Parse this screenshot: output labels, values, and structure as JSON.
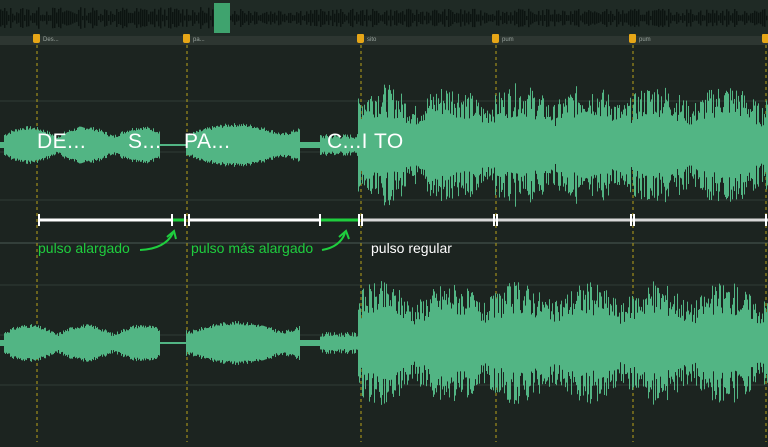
{
  "colors": {
    "background": "#1c2420",
    "waveform": "#52b584",
    "marker": "#e6a617",
    "annotation_green": "#1fce3e",
    "annotation_white": "#ffffff",
    "grid": "#3b4a44"
  },
  "markers": [
    {
      "label": "Des..."
    },
    {
      "label": "pa..."
    },
    {
      "label": "sito"
    },
    {
      "label": "pum"
    },
    {
      "label": "pum"
    },
    {
      "label": ""
    }
  ],
  "syllables": [
    "DE...",
    "S...",
    "PA...",
    "C...I TO"
  ],
  "annotations": {
    "pulse_long": "pulso alargado",
    "pulse_longer": "pulso más alargado",
    "pulse_regular": "pulso regular"
  }
}
